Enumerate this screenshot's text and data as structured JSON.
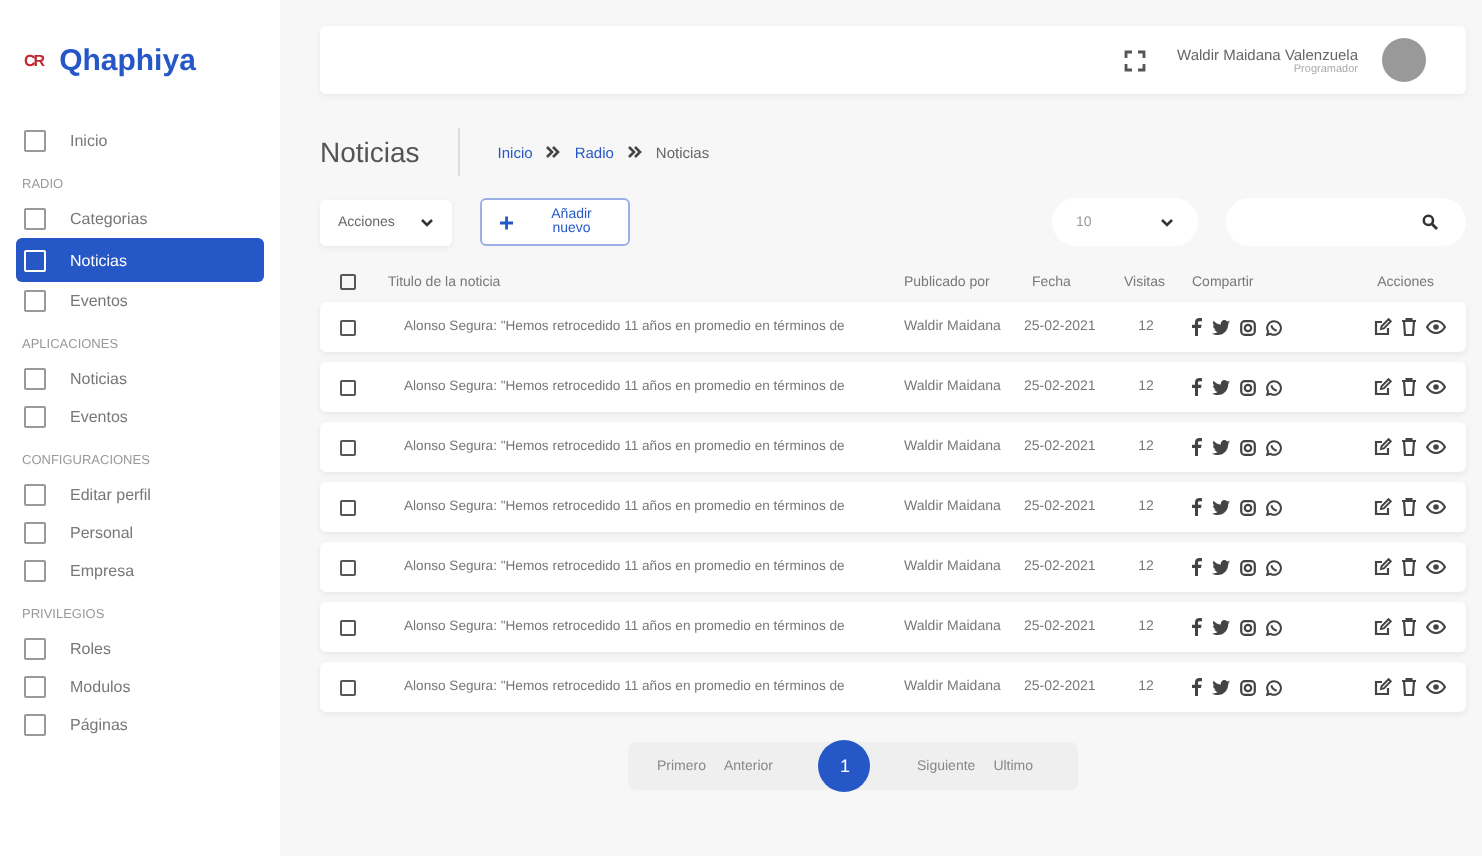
{
  "sidebar": {
    "logo_mark": "CR",
    "brand": "Qhaphiya",
    "items": [
      {
        "kind": "item",
        "label": "Inicio",
        "selected": false
      },
      {
        "kind": "section",
        "label": "RADIO"
      },
      {
        "kind": "item",
        "label": "Categorias",
        "selected": false
      },
      {
        "kind": "item",
        "label": "Noticias",
        "selected": true
      },
      {
        "kind": "item",
        "label": "Eventos",
        "selected": false
      },
      {
        "kind": "section",
        "label": "APLICACIONES"
      },
      {
        "kind": "item",
        "label": "Noticias",
        "selected": false
      },
      {
        "kind": "item",
        "label": "Eventos",
        "selected": false
      },
      {
        "kind": "section",
        "label": "CONFIGURACIONES"
      },
      {
        "kind": "item",
        "label": "Editar perfil",
        "selected": false
      },
      {
        "kind": "item",
        "label": "Personal",
        "selected": false
      },
      {
        "kind": "item",
        "label": "Empresa",
        "selected": false
      },
      {
        "kind": "section",
        "label": "PRIVILEGIOS"
      },
      {
        "kind": "item",
        "label": "Roles",
        "selected": false
      },
      {
        "kind": "item",
        "label": "Modulos",
        "selected": false
      },
      {
        "kind": "item",
        "label": "Páginas",
        "selected": false
      }
    ]
  },
  "topbar": {
    "user_name": "Waldir Maidana Valenzuela",
    "user_role": "Programador"
  },
  "page": {
    "title": "Noticias",
    "breadcrumb": [
      "Inicio",
      "Radio",
      "Noticias"
    ]
  },
  "toolbar": {
    "actions": "Acciones",
    "add": "Añadir nuevo",
    "page_size": "10"
  },
  "table": {
    "select_all_checked": false,
    "columns": [
      "Titulo de la noticia",
      "Publicado por",
      "Fecha",
      "Visitas",
      "Compartir",
      "Acciones"
    ],
    "rows": [
      {
        "checked": false,
        "title": "Alonso Segura: \"Hemos retrocedido 11 años en promedio en términos de",
        "author": "Waldir Maidana",
        "date": "25-02-2021",
        "visits": "12"
      },
      {
        "checked": false,
        "title": "Alonso Segura: \"Hemos retrocedido 11 años en promedio en términos de",
        "author": "Waldir Maidana",
        "date": "25-02-2021",
        "visits": "12"
      },
      {
        "checked": false,
        "title": "Alonso Segura: \"Hemos retrocedido 11 años en promedio en términos de",
        "author": "Waldir Maidana",
        "date": "25-02-2021",
        "visits": "12"
      },
      {
        "checked": false,
        "title": "Alonso Segura: \"Hemos retrocedido 11 años en promedio en términos de",
        "author": "Waldir Maidana",
        "date": "25-02-2021",
        "visits": "12"
      },
      {
        "checked": false,
        "title": "Alonso Segura: \"Hemos retrocedido 11 años en promedio en términos de",
        "author": "Waldir Maidana",
        "date": "25-02-2021",
        "visits": "12"
      },
      {
        "checked": false,
        "title": "Alonso Segura: \"Hemos retrocedido 11 años en promedio en términos de",
        "author": "Waldir Maidana",
        "date": "25-02-2021",
        "visits": "12"
      },
      {
        "checked": false,
        "title": "Alonso Segura: \"Hemos retrocedido 11 años en promedio en términos de",
        "author": "Waldir Maidana",
        "date": "25-02-2021",
        "visits": "12"
      }
    ]
  },
  "pagination": {
    "first": "Primero",
    "prev": "Anterior",
    "pages": [
      {
        "label": "1",
        "selected": true
      }
    ],
    "next": "Siguiente",
    "last": "Ultimo"
  }
}
